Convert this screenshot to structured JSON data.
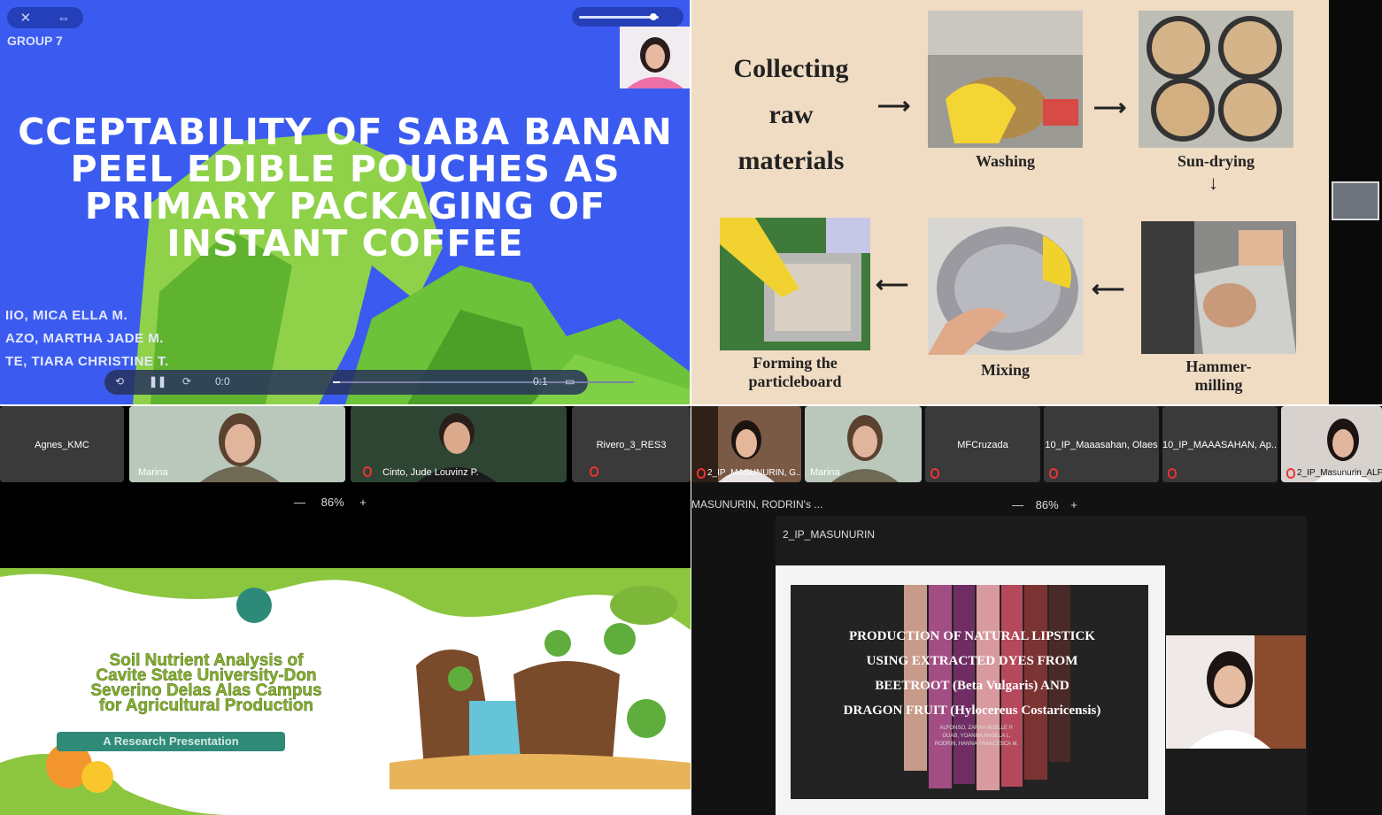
{
  "q1": {
    "group_label": "GROUP 7",
    "title_lines": [
      "CCEPTABILITY OF SABA BANAN",
      "PEEL EDIBLE POUCHES AS",
      "PRIMARY PACKAGING OF",
      "INSTANT COFFEE"
    ],
    "authors": [
      "IIO, MICA ELLA M.",
      "AZO, MARTHA JADE M.",
      "TE, TIARA CHRISTINE T."
    ],
    "player_time_left": "0:0",
    "player_time_right": "0:1"
  },
  "q2": {
    "start_label": "Collecting raw materials",
    "start_lines": [
      "Collecting",
      "raw",
      "materials"
    ],
    "steps": {
      "washing": "Washing",
      "sun_drying": "Sun-drying",
      "hammer_milling_1": "Hammer-",
      "hammer_milling_2": "milling",
      "mixing": "Mixing",
      "forming_1": "Forming the",
      "forming_2": "particleboard"
    }
  },
  "q3": {
    "participants": [
      "Agnes_KMC",
      "Marina",
      "Cinto, Jude Louvinz P.",
      "Rivero_3_RES3"
    ],
    "zoom": "86%",
    "slide_title_lines": [
      "Soil Nutrient Analysis of",
      "Cavite State University-Don",
      "Severino Delas Alas Campus",
      "for Agricultural Production"
    ],
    "slide_button": "A Research Presentation"
  },
  "q4": {
    "participants": [
      "2_IP_MASUNURIN, G...",
      "Marina",
      "MFCruzada",
      "10_IP_Maaasahan, Olaes",
      "10_IP_MAAASAHAN, Ap...",
      "2_IP_Masunurin_ALF..."
    ],
    "share_owner": "MASUNURIN, RODRIN's ...",
    "zoom": "86%",
    "share_title": "2_IP_MASUNURIN",
    "slide_title_lines": [
      "PRODUCTION OF NATURAL LIPSTICK",
      "USING EXTRACTED DYES FROM",
      "BEETROOT (Beta Vulgaris) AND",
      "DRAGON FRUIT (Hylocereus Costaricensis)"
    ],
    "slide_names": [
      "ALFONSO, ZARAH ADELLE P.",
      "GUAB, YOANNA ANGELA L.",
      "RODRIN, HANNA FRANCESCA M."
    ]
  },
  "colors": {
    "q1_bg": "#3b5bf0",
    "q2_bg": "#f0dcc3",
    "q3_green": "#86b22a",
    "q4_bg": "#121212"
  }
}
